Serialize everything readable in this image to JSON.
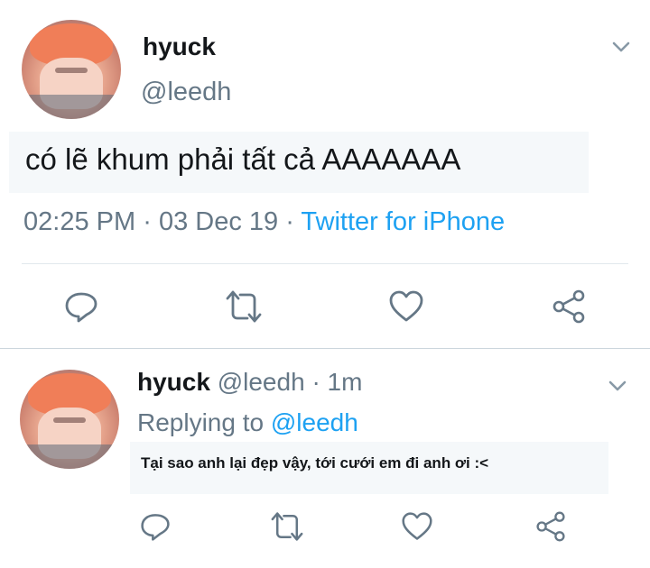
{
  "tweet": {
    "author_name": "hyuck",
    "author_handle": "@leedh",
    "text": "có lẽ khum phải tất cả AAAAAAA",
    "time": "02:25 PM",
    "sep1": "·",
    "date": "03 Dec 19",
    "sep2": "·",
    "source": "Twitter for iPhone"
  },
  "reply": {
    "author_name": "hyuck",
    "author_handle": "@leedh",
    "sep": "·",
    "age": "1m",
    "replying_prefix": "Replying to",
    "replying_handle": "@leedh",
    "text": "Tại sao anh lại đẹp vậy, tới cưới em đi anh ơi :<"
  },
  "icons": {
    "reply": "reply-icon",
    "retweet": "retweet-icon",
    "like": "heart-icon",
    "share": "share-icon",
    "menu": "chevron-down-icon"
  },
  "colors": {
    "accent": "#1da1f2",
    "muted": "#657786",
    "icon": "#657786",
    "text_bg": "#f5f8fa"
  }
}
